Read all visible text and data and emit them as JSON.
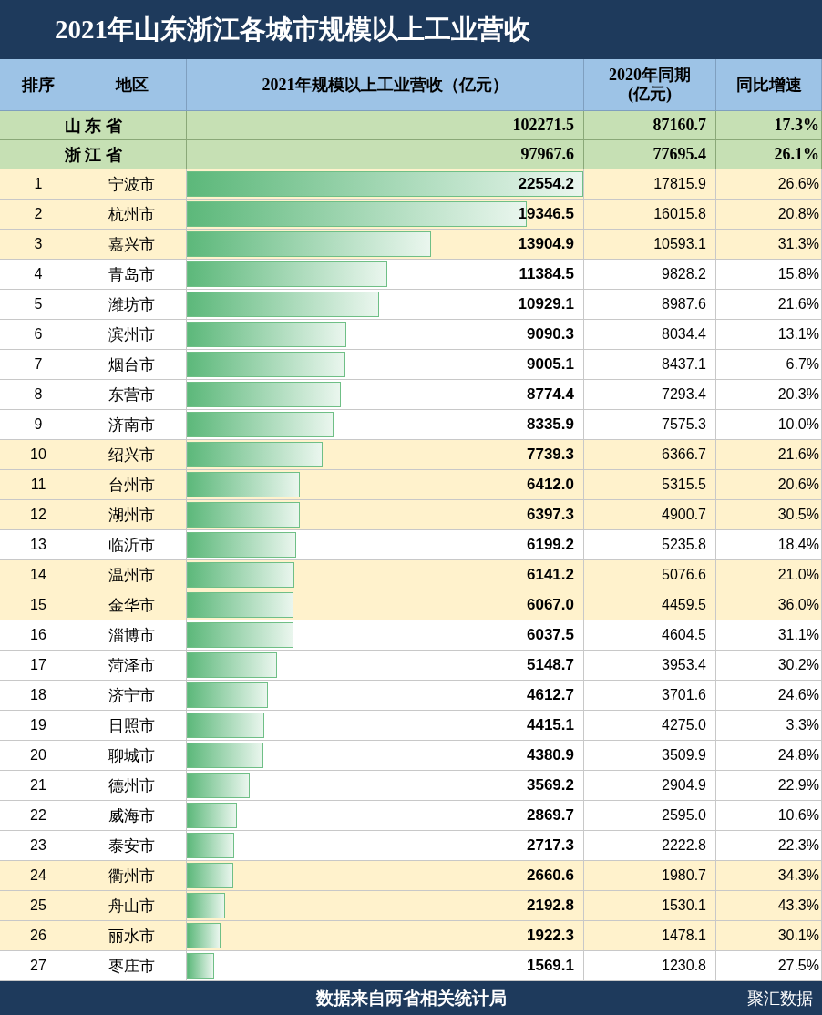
{
  "title": "2021年山东浙江各城市规模以上工业营收",
  "columns": [
    "排序",
    "地区",
    "2021年规模以上工业营收（亿元）",
    "2020年同期\n(亿元)",
    "同比增速"
  ],
  "provinces": [
    {
      "name": "山 东 省",
      "revenue_2021": "102271.5",
      "revenue_2020": "87160.7",
      "growth": "17.3%"
    },
    {
      "name": "浙 江 省",
      "revenue_2021": "97967.6",
      "revenue_2020": "77695.4",
      "growth": "26.1%"
    }
  ],
  "rows": [
    {
      "rank": "1",
      "city": "宁波市",
      "revenue_2021": "22554.2",
      "level": 1.0,
      "revenue_2020": "17815.9",
      "growth": "26.6%",
      "color": "#fff2cc"
    },
    {
      "rank": "2",
      "city": "杭州市",
      "revenue_2021": "19346.5",
      "level": 0.858,
      "revenue_2020": "16015.8",
      "growth": "20.8%",
      "color": "#fff2cc"
    },
    {
      "rank": "3",
      "city": "嘉兴市",
      "revenue_2021": "13904.9",
      "level": 0.616,
      "revenue_2020": "10593.1",
      "growth": "31.3%",
      "color": "#fff2cc"
    },
    {
      "rank": "4",
      "city": "青岛市",
      "revenue_2021": "11384.5",
      "level": 0.505,
      "revenue_2020": "9828.2",
      "growth": "15.8%",
      "color": "#ffffff"
    },
    {
      "rank": "5",
      "city": "潍坊市",
      "revenue_2021": "10929.1",
      "level": 0.485,
      "revenue_2020": "8987.6",
      "growth": "21.6%",
      "color": "#ffffff"
    },
    {
      "rank": "6",
      "city": "滨州市",
      "revenue_2021": "9090.3",
      "level": 0.403,
      "revenue_2020": "8034.4",
      "growth": "13.1%",
      "color": "#ffffff"
    },
    {
      "rank": "7",
      "city": "烟台市",
      "revenue_2021": "9005.1",
      "level": 0.399,
      "revenue_2020": "8437.1",
      "growth": "6.7%",
      "color": "#ffffff"
    },
    {
      "rank": "8",
      "city": "东营市",
      "revenue_2021": "8774.4",
      "level": 0.389,
      "revenue_2020": "7293.4",
      "growth": "20.3%",
      "color": "#ffffff"
    },
    {
      "rank": "9",
      "city": "济南市",
      "revenue_2021": "8335.9",
      "level": 0.37,
      "revenue_2020": "7575.3",
      "growth": "10.0%",
      "color": "#ffffff"
    },
    {
      "rank": "10",
      "city": "绍兴市",
      "revenue_2021": "7739.3",
      "level": 0.343,
      "revenue_2020": "6366.7",
      "growth": "21.6%",
      "color": "#fff2cc"
    },
    {
      "rank": "11",
      "city": "台州市",
      "revenue_2021": "6412.0",
      "level": 0.284,
      "revenue_2020": "5315.5",
      "growth": "20.6%",
      "color": "#fff2cc"
    },
    {
      "rank": "12",
      "city": "湖州市",
      "revenue_2021": "6397.3",
      "level": 0.284,
      "revenue_2020": "4900.7",
      "growth": "30.5%",
      "color": "#fff2cc"
    },
    {
      "rank": "13",
      "city": "临沂市",
      "revenue_2021": "6199.2",
      "level": 0.275,
      "revenue_2020": "5235.8",
      "growth": "18.4%",
      "color": "#ffffff"
    },
    {
      "rank": "14",
      "city": "温州市",
      "revenue_2021": "6141.2",
      "level": 0.272,
      "revenue_2020": "5076.6",
      "growth": "21.0%",
      "color": "#fff2cc"
    },
    {
      "rank": "15",
      "city": "金华市",
      "revenue_2021": "6067.0",
      "level": 0.269,
      "revenue_2020": "4459.5",
      "growth": "36.0%",
      "color": "#fff2cc"
    },
    {
      "rank": "16",
      "city": "淄博市",
      "revenue_2021": "6037.5",
      "level": 0.268,
      "revenue_2020": "4604.5",
      "growth": "31.1%",
      "color": "#ffffff"
    },
    {
      "rank": "17",
      "city": "菏泽市",
      "revenue_2021": "5148.7",
      "level": 0.228,
      "revenue_2020": "3953.4",
      "growth": "30.2%",
      "color": "#ffffff"
    },
    {
      "rank": "18",
      "city": "济宁市",
      "revenue_2021": "4612.7",
      "level": 0.205,
      "revenue_2020": "3701.6",
      "growth": "24.6%",
      "color": "#ffffff"
    },
    {
      "rank": "19",
      "city": "日照市",
      "revenue_2021": "4415.1",
      "level": 0.196,
      "revenue_2020": "4275.0",
      "growth": "3.3%",
      "color": "#ffffff"
    },
    {
      "rank": "20",
      "city": "聊城市",
      "revenue_2021": "4380.9",
      "level": 0.194,
      "revenue_2020": "3509.9",
      "growth": "24.8%",
      "color": "#ffffff"
    },
    {
      "rank": "21",
      "city": "德州市",
      "revenue_2021": "3569.2",
      "level": 0.158,
      "revenue_2020": "2904.9",
      "growth": "22.9%",
      "color": "#ffffff"
    },
    {
      "rank": "22",
      "city": "威海市",
      "revenue_2021": "2869.7",
      "level": 0.127,
      "revenue_2020": "2595.0",
      "growth": "10.6%",
      "color": "#ffffff"
    },
    {
      "rank": "23",
      "city": "泰安市",
      "revenue_2021": "2717.3",
      "level": 0.12,
      "revenue_2020": "2222.8",
      "growth": "22.3%",
      "color": "#ffffff"
    },
    {
      "rank": "24",
      "city": "衢州市",
      "revenue_2021": "2660.6",
      "level": 0.118,
      "revenue_2020": "1980.7",
      "growth": "34.3%",
      "color": "#fff2cc"
    },
    {
      "rank": "25",
      "city": "舟山市",
      "revenue_2021": "2192.8",
      "level": 0.097,
      "revenue_2020": "1530.1",
      "growth": "43.3%",
      "color": "#fff2cc"
    },
    {
      "rank": "26",
      "city": "丽水市",
      "revenue_2021": "1922.3",
      "level": 0.085,
      "revenue_2020": "1478.1",
      "growth": "30.1%",
      "color": "#fff2cc"
    },
    {
      "rank": "27",
      "city": "枣庄市",
      "revenue_2021": "1569.1",
      "level": 0.07,
      "revenue_2020": "1230.8",
      "growth": "27.5%",
      "color": "#ffffff"
    }
  ],
  "footer": {
    "source": "数据来自两省相关统计局",
    "brand": "聚汇数据"
  }
}
